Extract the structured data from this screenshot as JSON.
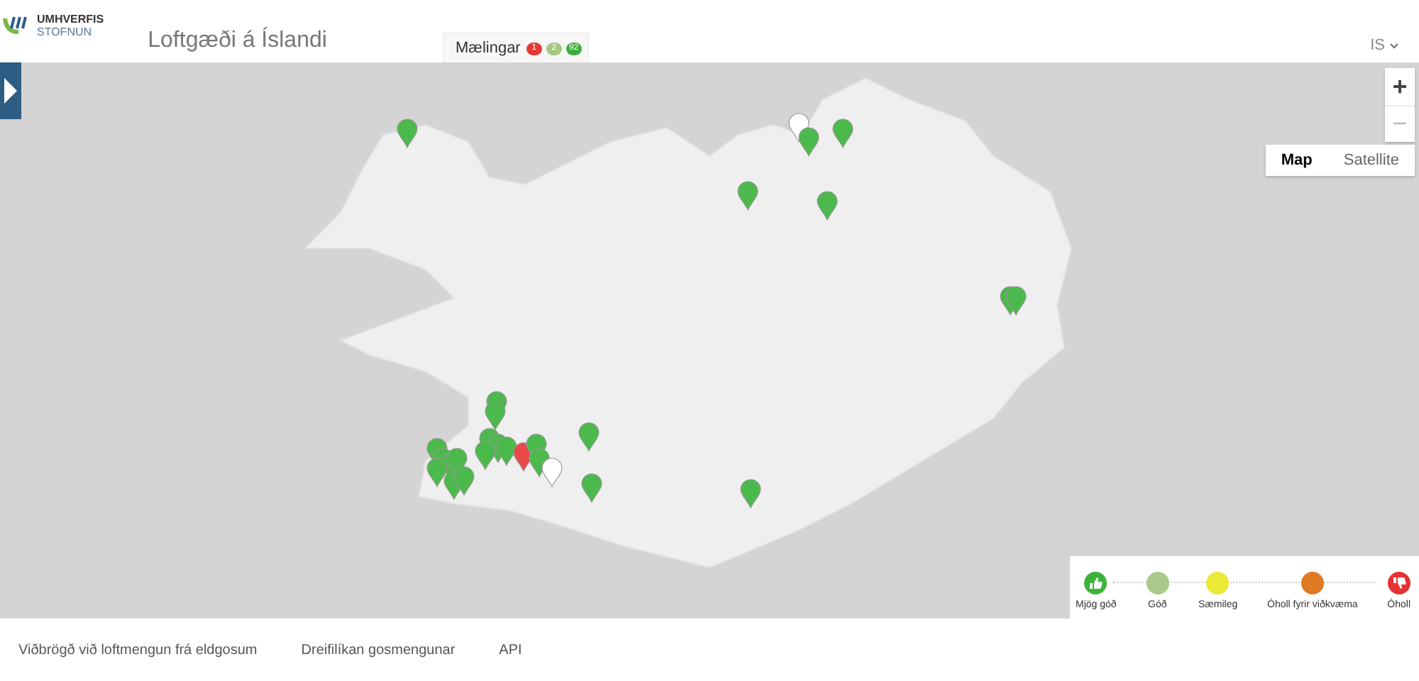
{
  "logo": {
    "line_1": "UMHVERFIS",
    "line_2": "STOFNUN"
  },
  "title": "Loftgæði á Íslandi",
  "tab": {
    "label": "Mælingar",
    "badges": [
      {
        "text": "1",
        "color": "#e53935"
      },
      {
        "text": "2",
        "color": "#a5c882"
      },
      {
        "text": "92",
        "color": "#3cae3c"
      }
    ]
  },
  "language": {
    "label": "IS"
  },
  "map": {
    "type_buttons": [
      {
        "label": "Map",
        "selected": true
      },
      {
        "label": "Satellite",
        "selected": false
      }
    ],
    "zoom_in": "+",
    "zoom_out": "−",
    "markers": [
      {
        "color": "#4cb94c"
      },
      {
        "color": "#ffffff"
      },
      {
        "color": "#4cb94c"
      },
      {
        "color": "#4cb94c"
      },
      {
        "color": "#4cb94c"
      },
      {
        "color": "#4cb94c"
      },
      {
        "color": "#4cb94c"
      },
      {
        "color": "#4cb94c"
      },
      {
        "color": "#4cb94c"
      },
      {
        "color": "#4cb94c"
      },
      {
        "color": "#4cb94c"
      },
      {
        "color": "#4cb94c"
      },
      {
        "color": "#4cb94c"
      },
      {
        "color": "#4cb94c"
      },
      {
        "color": "#4cb94c"
      },
      {
        "color": "#4cb94c"
      },
      {
        "color": "#4cb94c"
      },
      {
        "color": "#4cb94c"
      },
      {
        "color": "#4cb94c"
      },
      {
        "color": "#4cb94c"
      },
      {
        "color": "#4cb94c"
      },
      {
        "color": "#e84a4a"
      },
      {
        "color": "#4cb94c"
      },
      {
        "color": "#4cb94c"
      },
      {
        "color": "#ffffff"
      },
      {
        "color": "#4cb94c"
      },
      {
        "color": "#4cb94c"
      },
      {
        "color": "#4cb94c"
      }
    ]
  },
  "legend": [
    {
      "label": "Mjög góð",
      "color": "#3cb43c",
      "kind": "up"
    },
    {
      "label": "Góð",
      "color": "#a9c889",
      "kind": "plain"
    },
    {
      "label": "Sæmileg",
      "color": "#ebe836",
      "kind": "plain"
    },
    {
      "label": "Óholl fyrir viðkvæma",
      "color": "#e07a22",
      "kind": "plain"
    },
    {
      "label": "Óholl",
      "color": "#e53232",
      "kind": "down"
    }
  ],
  "footer_links": [
    "Viðbrögð við loftmengun frá eldgosum",
    "Dreifilíkan gosmengunar",
    "API"
  ]
}
